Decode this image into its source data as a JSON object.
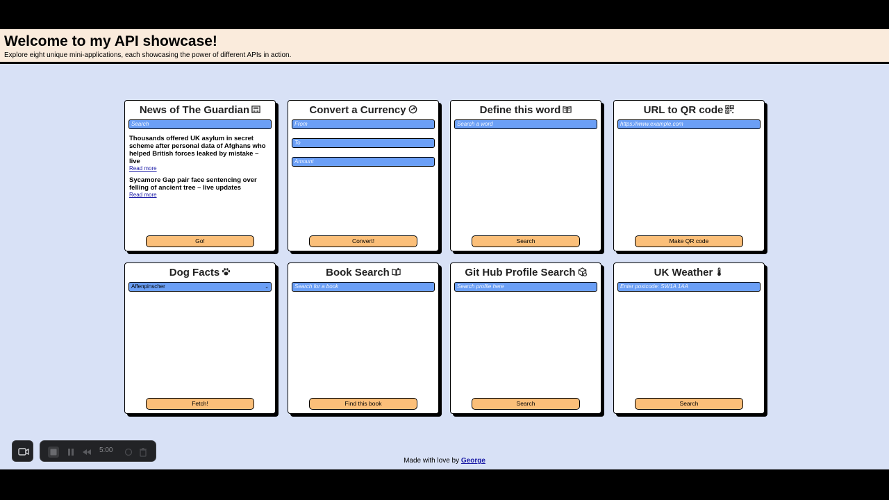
{
  "header": {
    "title": "Welcome to my API showcase!",
    "subtitle": "Explore eight unique mini-applications, each showcasing the power of different APIs in action."
  },
  "cards": {
    "news": {
      "title": "News of The Guardian",
      "icon": "newspaper-icon",
      "search_placeholder": "Search",
      "items": [
        {
          "headline": "Thousands offered UK asylum in secret scheme after personal data of Afghans who helped British forces leaked by mistake – live",
          "link": "Read more"
        },
        {
          "headline": "Sycamore Gap pair face sentencing over felling of ancient tree – live updates",
          "link": "Read more"
        }
      ],
      "button": "Go!"
    },
    "currency": {
      "title": "Convert a Currency",
      "icon": "exchange-icon",
      "from_placeholder": "From",
      "to_placeholder": "To",
      "amount_placeholder": "Amount",
      "button": "Convert!"
    },
    "define": {
      "title": "Define this word",
      "icon": "book-icon",
      "placeholder": "Search a word",
      "button": "Search"
    },
    "qr": {
      "title": "URL to QR code",
      "icon": "qr-code-icon",
      "placeholder": "https://www.example.com",
      "button": "Make QR code"
    },
    "dog": {
      "title": "Dog Facts",
      "icon": "paw-icon",
      "selected_breed": "Affenpinscher",
      "button": "Fetch!"
    },
    "book": {
      "title": "Book Search",
      "icon": "open-book-icon",
      "placeholder": "Search for a book",
      "button": "Find this book"
    },
    "github": {
      "title": "Git Hub Profile Search",
      "icon": "package-icon",
      "placeholder": "Search profile here",
      "button": "Search"
    },
    "weather": {
      "title": "UK Weather",
      "icon": "thermometer-icon",
      "placeholder": "Enter postcode: SW1A 1AA",
      "button": "Search"
    }
  },
  "footer": {
    "text": "Made with love by",
    "author": "George"
  },
  "recorder": {
    "time": "5:00"
  }
}
